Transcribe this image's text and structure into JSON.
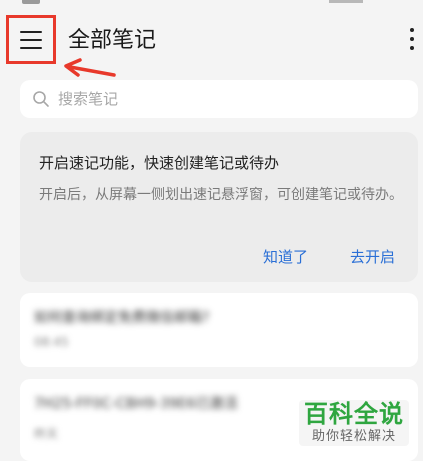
{
  "header": {
    "title": "全部笔记",
    "menu_icon": "hamburger-menu-icon",
    "more_icon": "more-vertical-icon"
  },
  "annotation": {
    "highlight_color": "#e8392b"
  },
  "search": {
    "placeholder": "搜索笔记",
    "value": ""
  },
  "tip_card": {
    "title": "开启速记功能，快速创建笔记或待办",
    "body": "开启后，从屏幕一侧划出速记悬浮窗，可创建笔记或待办。",
    "ok_label": "知道了",
    "open_label": "去开启",
    "accent_color": "#2a6fd6"
  },
  "notes": [
    {
      "title": "如何查询绑定免费微信邮箱?",
      "time": "08:45"
    },
    {
      "title": "7H25-FF0C-CBH9-39E6已激活",
      "time": "昨天"
    }
  ],
  "watermark": {
    "main": "百科全说",
    "sub": "助你轻松解决"
  }
}
